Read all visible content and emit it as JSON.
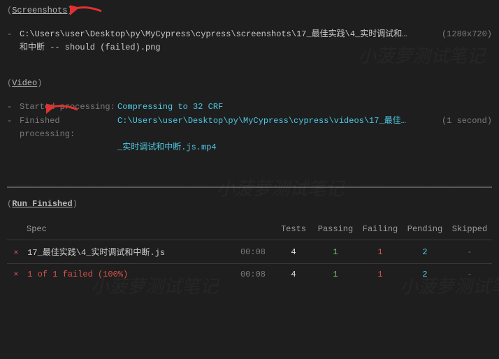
{
  "watermark": "小菠萝测试笔记",
  "screenshots": {
    "heading": "Screenshots",
    "items": [
      {
        "path_line1": "C:\\Users\\user\\Desktop\\py\\MyCypress\\cypress\\screenshots\\17_最佳实践\\4_实时调试和…",
        "path_line2": "和中断 -- should (failed).png",
        "meta": "(1280x720)"
      }
    ]
  },
  "video": {
    "heading": "Video",
    "started_label": "Started processing:",
    "started_value": "Compressing to 32 CRF",
    "finished_label": "Finished processing:",
    "finished_value_line1": "C:\\Users\\user\\Desktop\\py\\MyCypress\\cypress\\videos\\17_最佳…",
    "finished_value_line2": "_实时调试和中断.js.mp4",
    "finished_meta": "(1 second)"
  },
  "run_finished": {
    "heading": "Run Finished",
    "columns": {
      "spec": "Spec",
      "tests": "Tests",
      "passing": "Passing",
      "failing": "Failing",
      "pending": "Pending",
      "skipped": "Skipped"
    },
    "rows": [
      {
        "status": "×",
        "spec": "17_最佳实践\\4_实时调试和中断.js",
        "time": "00:08",
        "tests": "4",
        "passing": "1",
        "failing": "1",
        "pending": "2",
        "skipped": "-"
      }
    ],
    "summary": {
      "status": "×",
      "text": "1 of 1 failed (100%)",
      "time": "00:08",
      "tests": "4",
      "passing": "1",
      "failing": "1",
      "pending": "2",
      "skipped": "-"
    }
  }
}
